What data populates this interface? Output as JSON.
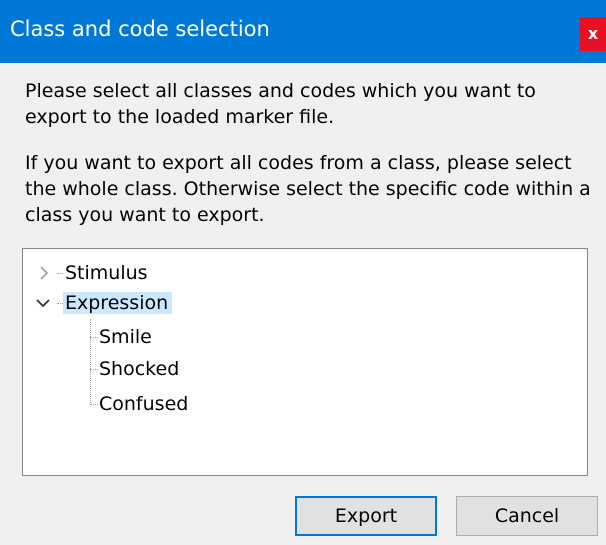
{
  "window": {
    "title": "Class and code selection",
    "close_label": "x"
  },
  "instructions": {
    "paragraph1": "Please select all classes and codes which you want to\nexport to the loaded marker file.",
    "paragraph2": "If you want to export all codes from a class, please select\nthe whole class. Otherwise select the specific code within a\nclass you want to export."
  },
  "tree": {
    "nodes": [
      {
        "label": "Stimulus",
        "expanded": false,
        "selected": false,
        "icon": "chevron-right-icon"
      },
      {
        "label": "Expression",
        "expanded": true,
        "selected": true,
        "icon": "chevron-down-icon",
        "children": [
          {
            "label": "Smile"
          },
          {
            "label": "Shocked"
          },
          {
            "label": "Confused"
          }
        ]
      }
    ]
  },
  "buttons": {
    "export_label": "Export",
    "cancel_label": "Cancel"
  },
  "colors": {
    "titlebar": "#0078d7",
    "close": "#e81123",
    "selection": "#cce8ff"
  }
}
